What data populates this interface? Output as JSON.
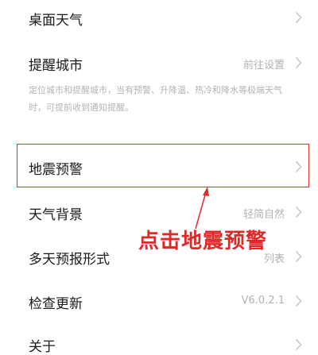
{
  "settings": {
    "desktop_weather": {
      "title": "桌面天气"
    },
    "reminder_city": {
      "title": "提醒城市",
      "value": "前往设置",
      "description": "定位城市和提醒城市，当有预警、升降温、热冷和降水等极端天气时，可提前收到通知提醒。"
    },
    "earthquake_warning": {
      "title": "地震预警"
    },
    "weather_background": {
      "title": "天气背景",
      "value": "轻简自然"
    },
    "multi_day_format": {
      "title": "多天预报形式",
      "value": "列表"
    },
    "check_update": {
      "title": "检查更新",
      "value": "V6.0.2.1"
    },
    "about": {
      "title": "关于"
    }
  },
  "annotation": {
    "text": "点击地震预警",
    "color": "#e02828"
  },
  "icons": {
    "row_chevron": "chevron-right-icon"
  }
}
